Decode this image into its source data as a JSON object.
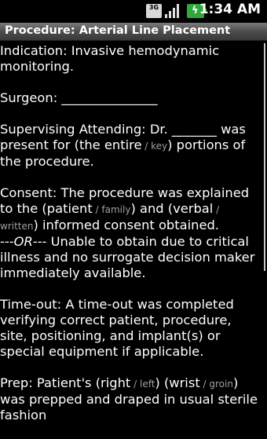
{
  "status": {
    "network": "3G",
    "time": "1:34 AM",
    "icons": [
      "3g-icon",
      "signal-icon",
      "battery-charging-icon"
    ]
  },
  "title": "Procedure: Arterial Line Placement",
  "note": {
    "indication": "Indication: Invasive hemodynamic monitoring.",
    "surgeon": "Surgeon: _______________",
    "supervising_1": "Supervising Attending: Dr. _______ was present for (the entire",
    "supervising_sep": " / ",
    "supervising_opt": "key",
    "supervising_2": ") portions of the procedure.",
    "consent_1": "Consent: The procedure was explained to the (patient",
    "consent_sep1": " / ",
    "consent_opt1": "family",
    "consent_2": ") and (verbal",
    "consent_sep2": " / ",
    "consent_opt2": "written",
    "consent_3": ") informed consent obtained.",
    "or_label": "---OR---",
    "consent_alt": " Unable to obtain due to critical illness and no surrogate decision maker immediately available.",
    "timeout": "Time-out: A time-out was completed verifying correct patient, procedure, site, positioning, and implant(s) or special equipment if applicable.",
    "prep_1": "Prep: Patient's (right",
    "prep_sep1": " / ",
    "prep_opt1": "left",
    "prep_2": ") (wrist",
    "prep_sep2": " / ",
    "prep_opt2": "groin",
    "prep_3": ") was prepped and draped in usual sterile fashion"
  }
}
